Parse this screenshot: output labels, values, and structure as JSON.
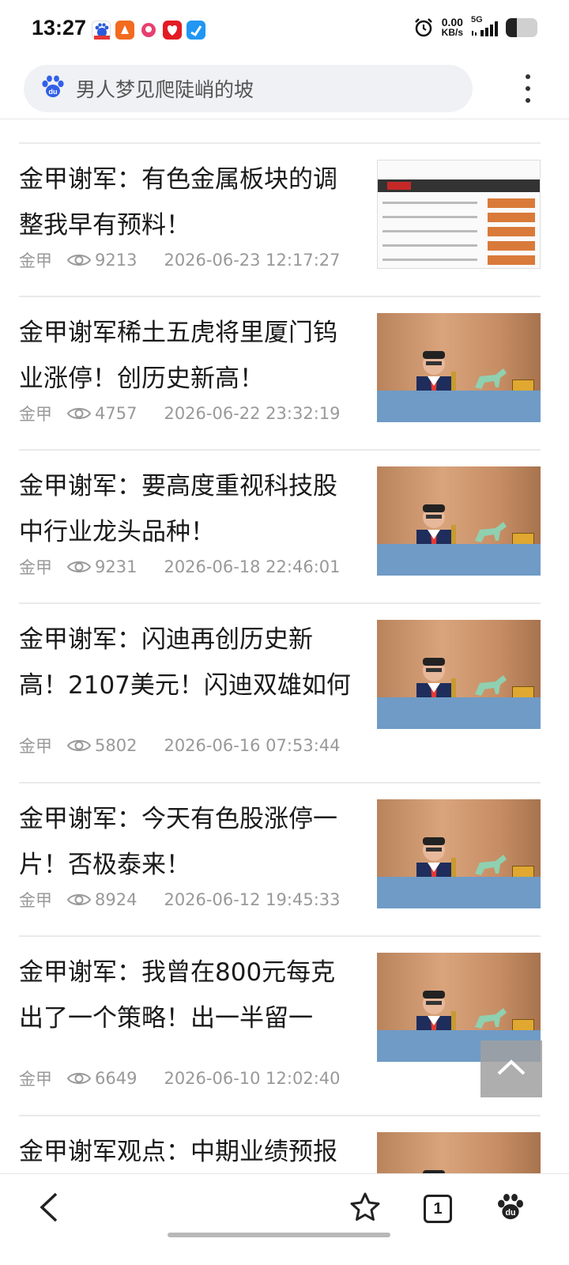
{
  "status": {
    "time": "13:27",
    "net_speed_value": "0.00",
    "net_speed_unit": "KB/s",
    "network": "5G",
    "battery_level": 0.35,
    "app_icons": [
      "baidu-app-icon",
      "orange-app-icon",
      "pink-app-icon",
      "red-app-icon",
      "blue-app-icon"
    ]
  },
  "search": {
    "placeholder": "男人梦见爬陡峭的坡",
    "logo": "baidu-paw-icon"
  },
  "feed": {
    "items": [
      {
        "title": "金甲谢军：有色金属板块的调整我早有预料！",
        "source": "金甲",
        "views": "9213",
        "date": "2026-06-23 12:17:27",
        "thumb": "document-screenshot"
      },
      {
        "title": "金甲谢军稀土五虎将里厦门钨业涨停！创历史新高！",
        "source": "金甲",
        "views": "4757",
        "date": "2026-06-22 23:32:19",
        "thumb": "speaker-photo"
      },
      {
        "title": "金甲谢军：要高度重视科技股中行业龙头品种！",
        "source": "金甲",
        "views": "9231",
        "date": "2026-06-18 22:46:01",
        "thumb": "speaker-photo"
      },
      {
        "title": "金甲谢军：闪迪再创历史新高！2107美元！闪迪双雄如何",
        "source": "金甲",
        "views": "5802",
        "date": "2026-06-16 07:53:44",
        "thumb": "speaker-photo"
      },
      {
        "title": "金甲谢军：今天有色股涨停一片！否极泰来！",
        "source": "金甲",
        "views": "8924",
        "date": "2026-06-12 19:45:33",
        "thumb": "speaker-photo"
      },
      {
        "title": "金甲谢军：我曾在800元每克出了一个策略！出一半留一",
        "source": "金甲",
        "views": "6649",
        "date": "2026-06-10 12:02:40",
        "thumb": "speaker-photo"
      },
      {
        "title": "金甲谢军观点：中期业绩预报",
        "source": "",
        "views": "",
        "date": "",
        "thumb": "speaker-photo"
      }
    ]
  },
  "nav": {
    "tab_count": "1",
    "icons": [
      "back-icon",
      "star-icon",
      "tabs-icon",
      "baidu-icon"
    ]
  }
}
